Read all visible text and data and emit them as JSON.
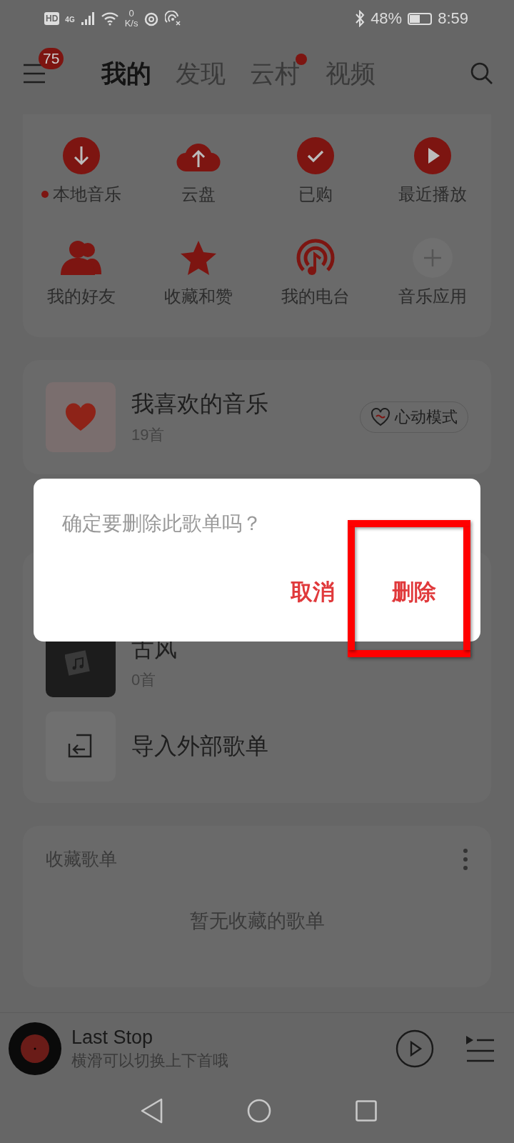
{
  "status_bar": {
    "hd": "HD",
    "network": "4G",
    "speed_value": "0",
    "speed_unit": "K/s",
    "battery": "48%",
    "time": "8:59"
  },
  "header": {
    "badge": "75",
    "tabs": [
      {
        "label": "我的",
        "selected": true,
        "dot": false
      },
      {
        "label": "发现",
        "selected": false,
        "dot": false
      },
      {
        "label": "云村",
        "selected": false,
        "dot": true
      },
      {
        "label": "视频",
        "selected": false,
        "dot": false
      }
    ]
  },
  "shortcuts": [
    {
      "label": "本地音乐",
      "dot": true,
      "kind": "download"
    },
    {
      "label": "云盘",
      "dot": false,
      "kind": "cloud"
    },
    {
      "label": "已购",
      "dot": false,
      "kind": "check"
    },
    {
      "label": "最近播放",
      "dot": false,
      "kind": "play"
    },
    {
      "label": "我的好友",
      "dot": false,
      "kind": "friends"
    },
    {
      "label": "收藏和赞",
      "dot": false,
      "kind": "star"
    },
    {
      "label": "我的电台",
      "dot": false,
      "kind": "radio"
    },
    {
      "label": "音乐应用",
      "dot": false,
      "kind": "add"
    }
  ],
  "liked": {
    "title": "我喜欢的音乐",
    "count": "19首",
    "mode_button": "心动模式"
  },
  "created_playlists": [
    {
      "title": "古风",
      "count": "0首"
    }
  ],
  "import": {
    "label": "导入外部歌单"
  },
  "collected": {
    "title": "收藏歌单",
    "empty": "暂无收藏的歌单"
  },
  "player": {
    "title": "Last Stop",
    "subtitle": "横滑可以切换上下首哦"
  },
  "dialog": {
    "message": "确定要删除此歌单吗？",
    "buttons": [
      {
        "label": "取消"
      },
      {
        "label": "删除"
      }
    ]
  }
}
